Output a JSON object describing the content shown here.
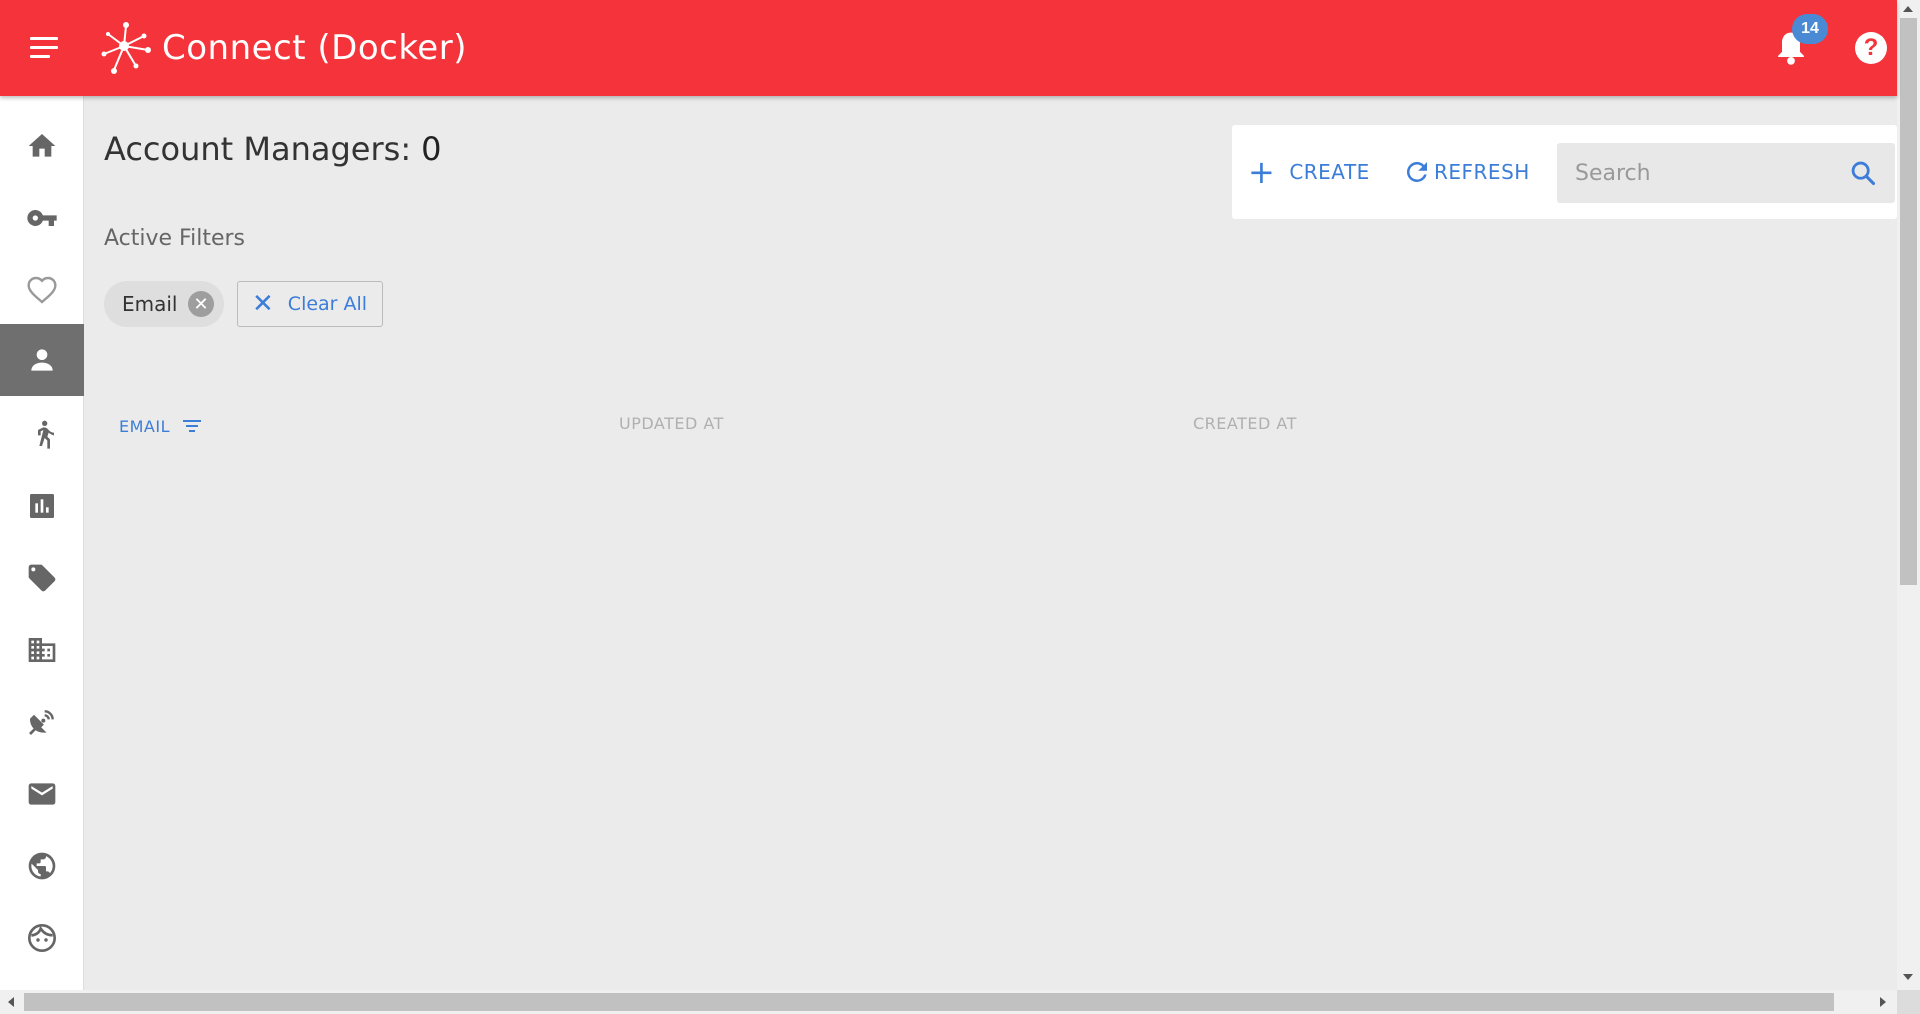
{
  "header": {
    "app_title": "Connect (Docker)",
    "notification_count": "14",
    "help_symbol": "?",
    "brand_color": "#f5333a"
  },
  "sidebar": {
    "items": [
      {
        "icon": "home-icon",
        "active": false
      },
      {
        "icon": "key-icon",
        "active": false
      },
      {
        "icon": "heart-icon",
        "active": false
      },
      {
        "icon": "person-icon",
        "active": true
      },
      {
        "icon": "running-person-icon",
        "active": false
      },
      {
        "icon": "bar-chart-icon",
        "active": false
      },
      {
        "icon": "tag-icon",
        "active": false
      },
      {
        "icon": "building-icon",
        "active": false
      },
      {
        "icon": "satellite-dish-icon",
        "active": false
      },
      {
        "icon": "mail-icon",
        "active": false
      },
      {
        "icon": "globe-icon",
        "active": false
      },
      {
        "icon": "face-icon",
        "active": false
      }
    ]
  },
  "main": {
    "title": "Account Managers:",
    "count": "0",
    "filters_label": "Active Filters",
    "filter_chip": "Email",
    "clear_all_label": "Clear All"
  },
  "toolbar": {
    "create_label": "CREATE",
    "refresh_label": "REFRESH",
    "search_placeholder": "Search",
    "accent_color": "#3b7dd8"
  },
  "table": {
    "columns": [
      "EMAIL",
      "UPDATED AT",
      "CREATED AT"
    ],
    "rows": []
  }
}
